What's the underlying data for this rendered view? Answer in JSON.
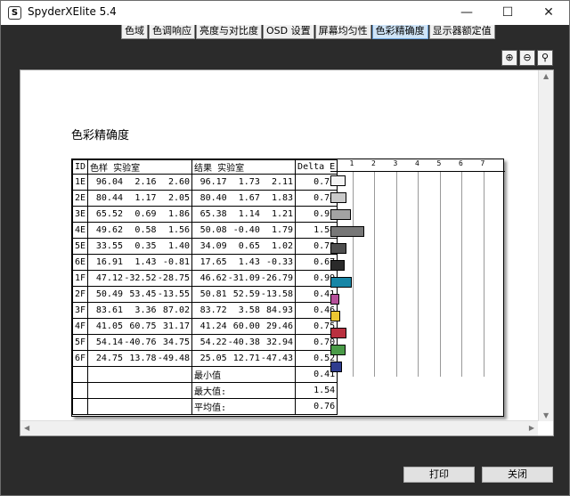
{
  "window": {
    "title": "SpyderXElite 5.4",
    "app_icon": "S"
  },
  "tabs": [
    "色域",
    "色调响应",
    "亮度与对比度",
    "OSD 设置",
    "屏幕均匀性",
    "色彩精确度",
    "显示器额定值"
  ],
  "active_tab": 5,
  "report": {
    "title": "色彩精确度",
    "headers": {
      "id": "ID",
      "sample": "色样 实验室",
      "result": "结果 实验室",
      "delta": "Delta E"
    },
    "ticks": [
      "1",
      "2",
      "3",
      "4",
      "5",
      "6",
      "7"
    ],
    "rows": [
      {
        "id": "1E",
        "s": [
          "96.04",
          "2.16",
          "2.60"
        ],
        "r": [
          "96.17",
          "1.73",
          "2.11"
        ],
        "de": "0.70",
        "color": "#f4f4f4"
      },
      {
        "id": "2E",
        "s": [
          "80.44",
          "1.17",
          "2.05"
        ],
        "r": [
          "80.40",
          "1.67",
          "1.83"
        ],
        "de": "0.74",
        "color": "#cacaca"
      },
      {
        "id": "3E",
        "s": [
          "65.52",
          "0.69",
          "1.86"
        ],
        "r": [
          "65.38",
          "1.14",
          "1.21"
        ],
        "de": "0.92",
        "color": "#a3a3a3"
      },
      {
        "id": "4E",
        "s": [
          "49.62",
          "0.58",
          "1.56"
        ],
        "r": [
          "50.08",
          "-0.40",
          "1.79"
        ],
        "de": "1.54",
        "color": "#777777"
      },
      {
        "id": "5E",
        "s": [
          "33.55",
          "0.35",
          "1.40"
        ],
        "r": [
          "34.09",
          "0.65",
          "1.02"
        ],
        "de": "0.73",
        "color": "#4f4f4f"
      },
      {
        "id": "6E",
        "s": [
          "16.91",
          "1.43",
          "-0.81"
        ],
        "r": [
          "17.65",
          "1.43",
          "-0.33"
        ],
        "de": "0.67",
        "color": "#2a2a2a"
      },
      {
        "id": "1F",
        "s": [
          "47.12",
          "-32.52",
          "-28.75"
        ],
        "r": [
          "46.62",
          "-31.09",
          "-26.79"
        ],
        "de": "0.99",
        "color": "#1786a6"
      },
      {
        "id": "2F",
        "s": [
          "50.49",
          "53.45",
          "-13.55"
        ],
        "r": [
          "50.81",
          "52.59",
          "-13.58"
        ],
        "de": "0.41",
        "color": "#b5509a"
      },
      {
        "id": "3F",
        "s": [
          "83.61",
          "3.36",
          "87.02"
        ],
        "r": [
          "83.72",
          "3.58",
          "84.93"
        ],
        "de": "0.46",
        "color": "#ecc632"
      },
      {
        "id": "4F",
        "s": [
          "41.05",
          "60.75",
          "31.17"
        ],
        "r": [
          "41.24",
          "60.00",
          "29.46"
        ],
        "de": "0.75",
        "color": "#b9303f"
      },
      {
        "id": "5F",
        "s": [
          "54.14",
          "-40.76",
          "34.75"
        ],
        "r": [
          "54.22",
          "-40.38",
          "32.94"
        ],
        "de": "0.70",
        "color": "#4a9b48"
      },
      {
        "id": "6F",
        "s": [
          "24.75",
          "13.78",
          "-49.48"
        ],
        "r": [
          "25.05",
          "12.71",
          "-47.43"
        ],
        "de": "0.52",
        "color": "#2f3d8f"
      }
    ],
    "summary": [
      {
        "label": "最小值",
        "value": "0.41"
      },
      {
        "label": "最大值:",
        "value": "1.54"
      },
      {
        "label": "平均值:",
        "value": "0.76"
      }
    ]
  },
  "buttons": {
    "print": "打印",
    "close": "关闭"
  }
}
